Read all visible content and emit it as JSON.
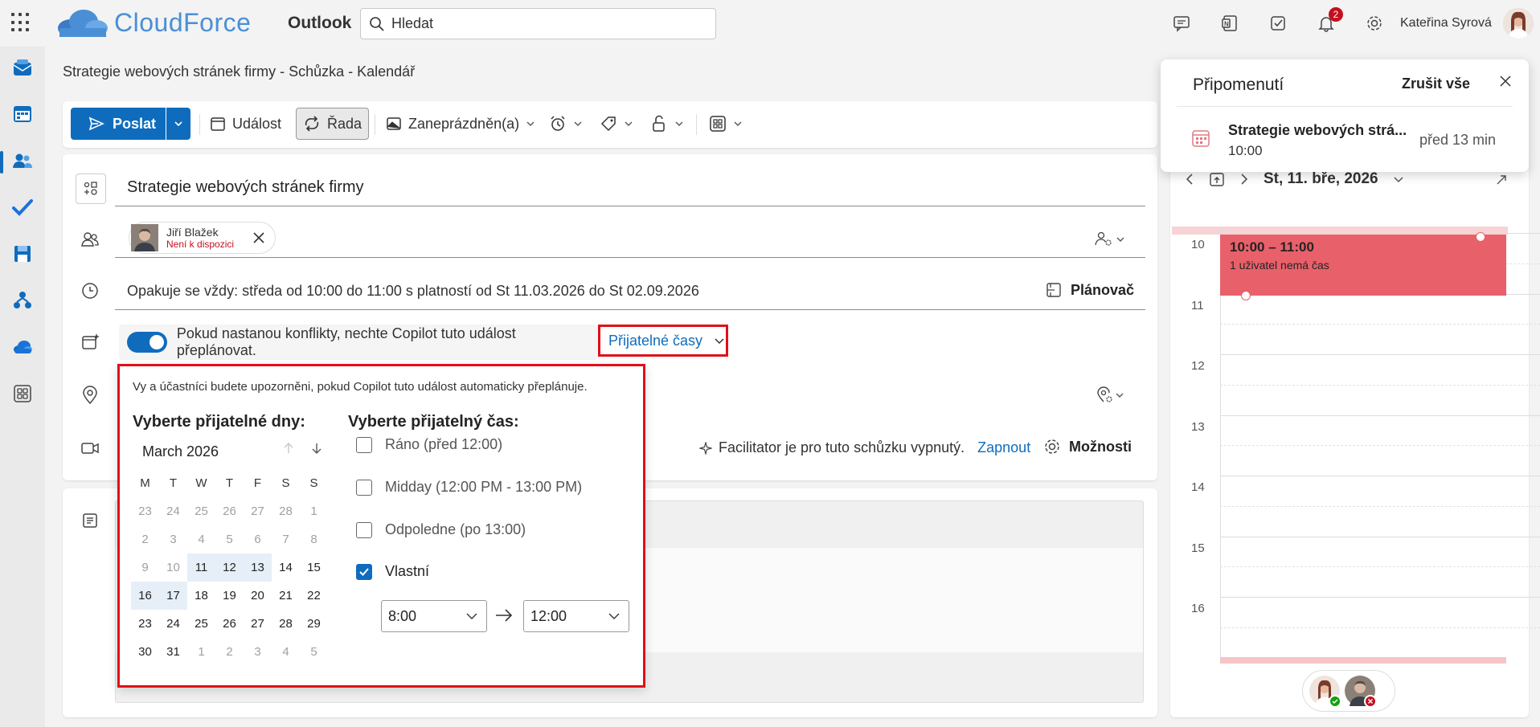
{
  "header": {
    "logo_text": "CloudForce",
    "app_name": "Outlook",
    "search_placeholder": "Hledat",
    "notifications_count": "2",
    "user_name": "Kateřina Syrová"
  },
  "breadcrumb": "Strategie webových stránek firmy - Schůzka - Kalendář",
  "toolbar": {
    "send_label": "Poslat",
    "event_label": "Událost",
    "series_label": "Řada",
    "busy_label": "Zaneprázdněn(a)"
  },
  "form": {
    "title": "Strategie webových stránek firmy",
    "attendee": {
      "name": "Jiří Blažek",
      "status": "Není k dispozici"
    },
    "recurrence": "Opakuje se vždy: středa od 10:00 do 11:00 s platností od St 11.03.2026 do St 02.09.2026",
    "planner_label": "Plánovač",
    "copilot_text": "Pokud nastanou konflikty, nechte Copilot tuto událost přeplánovat.",
    "acceptable_times_label": "Přijatelné časy",
    "facilitator_text": "Facilitator je pro tuto schůzku vypnutý.",
    "facilitator_link": "Zapnout",
    "options_label": "Možnosti"
  },
  "popup": {
    "info": "Vy a účastníci budete upozorněni, pokud Copilot tuto událost automaticky přeplánuje.",
    "days_heading": "Vyberte přijatelné dny:",
    "time_heading": "Vyberte přijatelný čas:",
    "month": "March 2026",
    "weekdays": [
      "M",
      "T",
      "W",
      "T",
      "F",
      "S",
      "S"
    ],
    "weeks": [
      [
        "23",
        "24",
        "25",
        "26",
        "27",
        "28",
        "1"
      ],
      [
        "2",
        "3",
        "4",
        "5",
        "6",
        "7",
        "8"
      ],
      [
        "9",
        "10",
        "11",
        "12",
        "13",
        "14",
        "15"
      ],
      [
        "16",
        "17",
        "18",
        "19",
        "20",
        "21",
        "22"
      ],
      [
        "23",
        "24",
        "25",
        "26",
        "27",
        "28",
        "29"
      ],
      [
        "30",
        "31",
        "1",
        "2",
        "3",
        "4",
        "5"
      ]
    ],
    "options": [
      {
        "label": "Ráno (před 12:00)",
        "checked": false
      },
      {
        "label": "Midday (12:00 PM - 13:00 PM)",
        "checked": false
      },
      {
        "label": "Odpoledne (po 13:00)",
        "checked": false
      },
      {
        "label": "Vlastní",
        "checked": true
      }
    ],
    "time_from": "8:00",
    "time_to": "12:00"
  },
  "right_pane": {
    "date_label": "St, 11. bře, 2026",
    "hours": [
      "10",
      "11",
      "12",
      "13",
      "14",
      "15",
      "16"
    ],
    "event_time": "10:00 – 11:00",
    "event_note": "1 uživatel nemá čas"
  },
  "reminder": {
    "title": "Připomenutí",
    "dismiss_all": "Zrušit vše",
    "event_title": "Strategie webových strá...",
    "event_time": "10:00",
    "ago": "před 13 min"
  },
  "colors": {
    "accent": "#0f6cbd",
    "highlight_border": "#e0101a",
    "event_red": "#e8606a",
    "unavailable_red": "#c50f1f"
  }
}
